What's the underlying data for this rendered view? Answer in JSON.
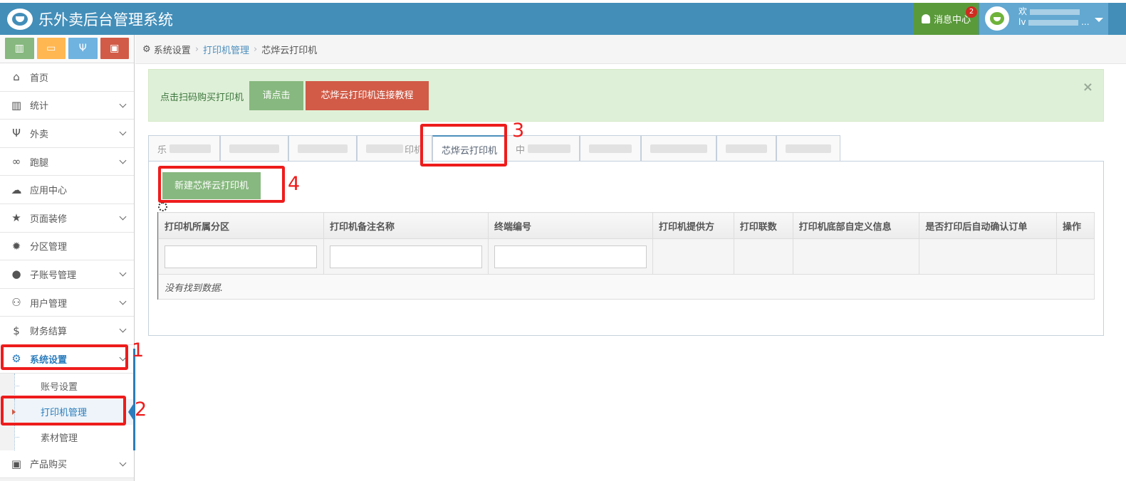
{
  "app": {
    "title": "乐外卖后台管理系统"
  },
  "navbar": {
    "messages_label": "消息中心",
    "messages_count": "2",
    "user_greeting": "欢",
    "user_sub": "lv",
    "user_more": "..."
  },
  "shortcuts": [
    {
      "icon": "bar-chart-icon",
      "color": "#87b87f"
    },
    {
      "icon": "desktop-icon",
      "color": "#ffb752"
    },
    {
      "icon": "cutlery-icon",
      "color": "#6fb3e0"
    },
    {
      "icon": "shopping-bag-icon",
      "color": "#d15b47"
    }
  ],
  "sidebar": {
    "items": [
      {
        "label": "首页",
        "icon": "home-icon"
      },
      {
        "label": "统计",
        "icon": "bar-chart-icon"
      },
      {
        "label": "外卖",
        "icon": "cutlery-icon"
      },
      {
        "label": "跑腿",
        "icon": "bicycle-icon"
      },
      {
        "label": "应用中心",
        "icon": "cloud-icon"
      },
      {
        "label": "页面装修",
        "icon": "star-icon"
      },
      {
        "label": "分区管理",
        "icon": "gear-badge-icon"
      },
      {
        "label": "子账号管理",
        "icon": "user-icon"
      },
      {
        "label": "用户管理",
        "icon": "users-icon"
      },
      {
        "label": "财务结算",
        "icon": "dollar-icon"
      },
      {
        "label": "系统设置",
        "icon": "cog-icon"
      },
      {
        "label": "产品购买",
        "icon": "shopping-bag-icon"
      }
    ],
    "subitems": [
      {
        "label": "账号设置"
      },
      {
        "label": "打印机管理"
      },
      {
        "label": "素材管理"
      }
    ]
  },
  "breadcrumb": {
    "root": "系统设置",
    "middle": "打印机管理",
    "current": "芯烨云打印机"
  },
  "alert": {
    "text": "点击扫码购买打印机",
    "button_click": "请点击",
    "button_tutorial": "芯烨云打印机连接教程",
    "close": "×"
  },
  "tabs": [
    {
      "label": "乐"
    },
    {
      "label": ""
    },
    {
      "label": ""
    },
    {
      "label": "印机"
    },
    {
      "label": "芯烨云打印机"
    },
    {
      "label": "中"
    },
    {
      "label": ""
    },
    {
      "label": ""
    },
    {
      "label": ""
    },
    {
      "label": ""
    }
  ],
  "main": {
    "new_button": "新建芯烨云打印机",
    "columns": [
      "打印机所属分区",
      "打印机备注名称",
      "终端编号",
      "打印机提供方",
      "打印联数",
      "打印机底部自定义信息",
      "是否打印后自动确认订单",
      "操作"
    ],
    "empty_text": "没有找到数据."
  },
  "annotations": [
    "1",
    "2",
    "3",
    "4"
  ],
  "colors": {
    "navbar": "#438eb9",
    "message_bg": "#5a9a3a",
    "user_bg": "#62a8d1",
    "success_btn": "#87b87f",
    "danger_btn": "#d15b47",
    "annotation_red": "#ee1c1c",
    "link": "#4c8fbd"
  }
}
